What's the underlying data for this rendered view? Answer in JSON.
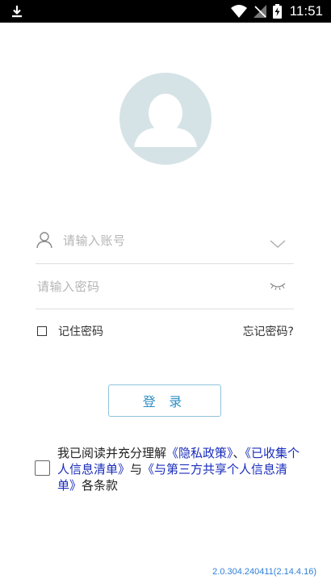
{
  "status_bar": {
    "time": "11:51"
  },
  "login": {
    "account_placeholder": "请输入账号",
    "password_placeholder": "请输入密码",
    "remember_label": "记住密码",
    "forgot_label": "忘记密码?",
    "login_button": "登 录"
  },
  "agreement": {
    "prefix": "我已阅读并充分理解",
    "privacy_link": "《隐私政策》",
    "sep1": "、",
    "collected_link": "《已收集个人信息清单》",
    "with": "与",
    "third_party_link": "《与第三方共享个人信息清单》",
    "suffix": "各条款"
  },
  "version": "2.0.304.240411(2.14.4.16)",
  "colors": {
    "link": "#1a2dbb",
    "button_text": "#2f8fc4",
    "version": "#2e7fd8",
    "avatar_bg": "#d6e3e6"
  }
}
